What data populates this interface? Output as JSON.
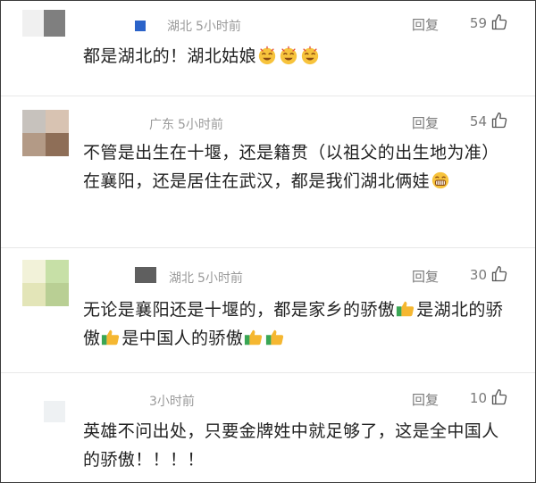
{
  "comments": [
    {
      "username": "",
      "location": "湖北",
      "time": "5小时前",
      "reply_label": "回复",
      "likes": "59",
      "text_parts": [
        "都是湖北的！湖北姑娘"
      ],
      "emojis": [
        "laughing-emoji",
        "laughing-emoji",
        "laughing-emoji"
      ],
      "avatar_colors": [
        "#b9b9b9",
        "#9a9a9a",
        "#e6e6e6",
        "#d6d6d6"
      ]
    },
    {
      "username": "",
      "location": "广东",
      "time": "5小时前",
      "reply_label": "回复",
      "likes": "54",
      "text_parts": [
        "不管是出生在十堰，还是籍贯（以祖父的出生地为准）在襄阳，还是居住在武汉，都是我们湖北俩娃"
      ],
      "emojis": [
        "grinning-emoji"
      ],
      "avatar_colors": [
        "#c7c2bd",
        "#c9b7a9",
        "#b39a86",
        "#9c7e68"
      ]
    },
    {
      "username": "",
      "location": "湖北",
      "time": "5小时前",
      "reply_label": "回复",
      "likes": "30",
      "text_parts": [
        "无论是襄阳还是十堰的，都是家乡的骄傲",
        "是湖北的骄傲",
        "是中国人的骄傲"
      ],
      "emojis": [
        "thumbs-up-emoji"
      ],
      "avatar_colors": [
        "#f2f2d9",
        "#c7e0a7",
        "#e3e5b8",
        "#b9cf94"
      ]
    },
    {
      "username": "",
      "location": "",
      "time": "3小时前",
      "reply_label": "回复",
      "likes": "10",
      "text_parts": [
        "英雄不问出处，只要金牌姓中就足够了，这是全中国人的骄傲！！！！"
      ],
      "emojis": [],
      "avatar_colors": [
        "#eef1f3",
        "#f5f6f7",
        "#f2f4f5",
        "#f7f8f9"
      ]
    }
  ],
  "icons": {
    "like": "thumbs-up-outline-icon"
  },
  "colors": {
    "meta_text": "#9a9a9a",
    "body_text": "#222222",
    "divider": "#e8e8e8",
    "border": "#3a3a3a"
  }
}
